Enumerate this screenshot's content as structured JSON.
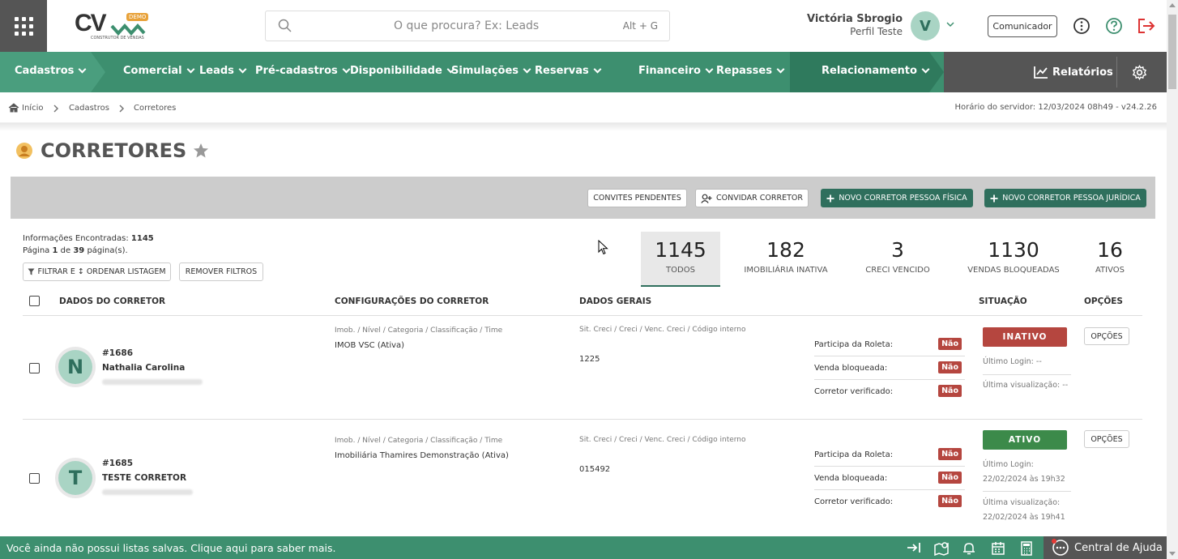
{
  "header": {
    "logo_text": "CV",
    "logo_badge": "DEMO",
    "logo_sub": "CONSTRUTOR DE VENDAS",
    "search_placeholder": "O que procura? Ex: Leads",
    "search_shortcut": "Alt + G",
    "user_name": "Victória Sbrogio",
    "user_profile": "Perfil Teste",
    "user_initial": "V",
    "comunicador_label": "Comunicador"
  },
  "nav": {
    "items": [
      "Cadastros",
      "Comercial",
      "Leads",
      "Pré-cadastros",
      "Disponibilidade",
      "Simulações",
      "Reservas",
      "Financeiro",
      "Repasses",
      "Relacionamento"
    ],
    "relatorios": "Relatórios"
  },
  "breadcrumb": {
    "items": [
      "Início",
      "Cadastros",
      "Corretores"
    ],
    "server_time": "Horário do servidor: 12/03/2024 08h49 - v24.2.26"
  },
  "page": {
    "title": "CORRETORES"
  },
  "actions": {
    "convites": "CONVITES PENDENTES",
    "convidar": "CONVIDAR CORRETOR",
    "novo_pf": "NOVO CORRETOR PESSOA FÍSICA",
    "novo_pj": "NOVO CORRETOR PESSOA JURÍDICA"
  },
  "info": {
    "found_label": "Informações Encontradas:",
    "found_count": "1145",
    "page_label_a": "Página",
    "page_current": "1",
    "page_label_b": "de",
    "page_total": "39",
    "page_label_c": "página(s).",
    "filter_btn": "FILTRAR E ↕ ORDENAR LISTAGEM",
    "remove_btn": "REMOVER FILTROS"
  },
  "stats": [
    {
      "num": "1145",
      "label": "TODOS"
    },
    {
      "num": "182",
      "label": "IMOBILIÁRIA INATIVA"
    },
    {
      "num": "3",
      "label": "CRECI VENCIDO"
    },
    {
      "num": "1130",
      "label": "VENDAS BLOQUEADAS"
    },
    {
      "num": "16",
      "label": "ATIVOS"
    }
  ],
  "table": {
    "headers": [
      "DADOS DO CORRETOR",
      "CONFIGURAÇÕES DO CORRETOR",
      "DADOS GERAIS",
      "SITUAÇÃO",
      "OPÇÕES"
    ],
    "config_caption": "Imob. / Nível / Categoria / Classificação / Time",
    "dados_caption": "Sit. Creci / Creci / Venc. Creci / Código interno",
    "flag_labels": [
      "Participa da Roleta:",
      "Venda bloqueada:",
      "Corretor verificado:"
    ],
    "no_label": "Não",
    "options_label": "OPÇÕES",
    "rows": [
      {
        "initial": "N",
        "id": "#1686",
        "name": "Nathalia Carolina",
        "config": "IMOB VSC (Ativa)",
        "creci": "1225",
        "status": "INATIVO",
        "status_color": "#b5463f",
        "last_login_label": "Último Login: --",
        "last_view_label": "Última visualização: --"
      },
      {
        "initial": "T",
        "id": "#1685",
        "name": "TESTE CORRETOR",
        "config": "Imobiliária Thamires Demonstração (Ativa)",
        "creci": "015492",
        "status": "ATIVO",
        "status_color": "#3c8a4a",
        "last_login_label": "Último Login:",
        "last_login_value": "22/02/2024 às 19h32",
        "last_view_label": "Última visualização:",
        "last_view_value": "22/02/2024 às 19h41"
      }
    ]
  },
  "footer": {
    "message": "Você ainda não possui listas salvas. Clique aqui para saber mais.",
    "help": "Central de Ajuda"
  },
  "colors": {
    "nav_green": "#3d8f6f",
    "dark_green": "#2f6f5d",
    "red": "#b5463f"
  }
}
